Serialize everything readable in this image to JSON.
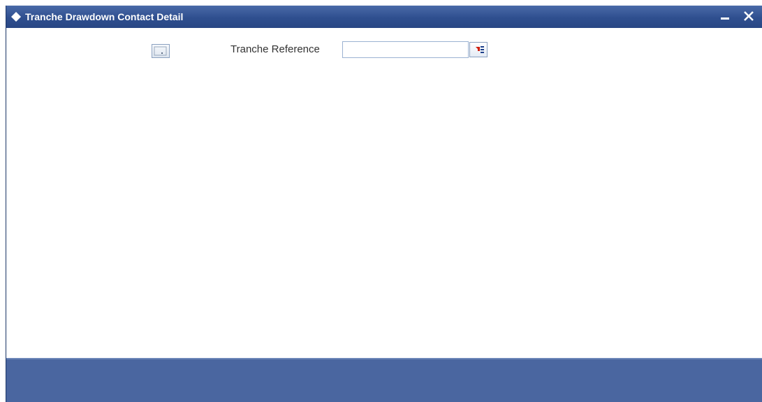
{
  "window": {
    "title": "Tranche Drawdown Contact Detail",
    "icons": {
      "title": "diamond-icon",
      "minimize": "minimize-icon",
      "close": "close-icon"
    }
  },
  "form": {
    "tranche_reference": {
      "label": "Tranche Reference",
      "value": "",
      "lov_icon": "list-of-values-icon"
    }
  },
  "colors": {
    "titlebar": "#2f4f8f",
    "footer": "#4a66a0",
    "text": "#333333"
  }
}
